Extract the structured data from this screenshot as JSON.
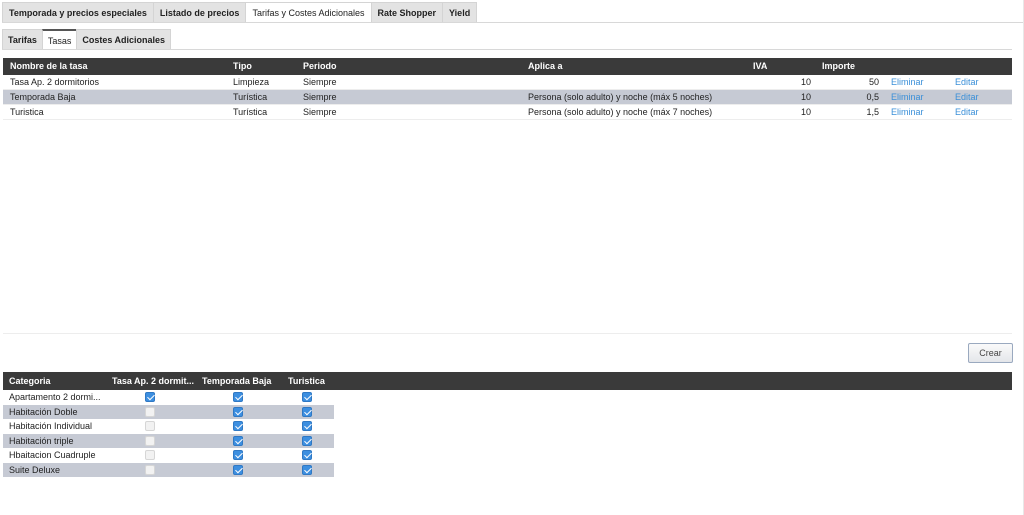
{
  "top_tabs": [
    "Temporada y precios especiales",
    "Listado de precios",
    "Tarifas y  Costes Adicionales",
    "Rate Shopper",
    "Yield"
  ],
  "sub_tabs": [
    "Tarifas",
    "Tasas",
    "Costes Adicionales"
  ],
  "taxes": {
    "headers": {
      "name": "Nombre de la tasa",
      "tipo": "Tipo",
      "periodo": "Periodo",
      "aplica": "Aplica a",
      "iva": "IVA",
      "importe": "Importe"
    },
    "rows": [
      {
        "name": "Tasa Ap. 2 dormitorios",
        "tipo": "Limpieza",
        "periodo": "Siempre",
        "aplica": "",
        "iva": "10",
        "importe": "50",
        "delete": "Eliminar",
        "edit": "Editar"
      },
      {
        "name": "Temporada Baja",
        "tipo": "Turística",
        "periodo": "Siempre",
        "aplica": "Persona (solo adulto)  y noche (máx 5 noches)",
        "iva": "10",
        "importe": "0,5",
        "delete": "Eliminar",
        "edit": "Editar"
      },
      {
        "name": "Turistica",
        "tipo": "Turística",
        "periodo": "Siempre",
        "aplica": "Persona (solo adulto)  y noche (máx 7 noches)",
        "iva": "10",
        "importe": "1,5",
        "delete": "Eliminar",
        "edit": "Editar"
      }
    ]
  },
  "create_button": "Crear",
  "categories": {
    "headers": {
      "cat": "Categoria",
      "h1": "Tasa Ap. 2 dormit...",
      "h2": "Temporada Baja",
      "h3": "Turistica"
    },
    "rows": [
      {
        "name": "Apartamento 2 dormi...",
        "checks": [
          true,
          true,
          true
        ]
      },
      {
        "name": "Habitación Doble",
        "checks": [
          false,
          true,
          true
        ]
      },
      {
        "name": "Habitación Individual",
        "checks": [
          false,
          true,
          true
        ]
      },
      {
        "name": "Habitación triple",
        "checks": [
          false,
          true,
          true
        ]
      },
      {
        "name": "Hbaitacion Cuadruple",
        "checks": [
          false,
          true,
          true
        ]
      },
      {
        "name": "Suite Deluxe",
        "checks": [
          false,
          true,
          true
        ]
      }
    ]
  },
  "colors": {
    "header_bg": "#3a3a3a",
    "row_alt": "#c6cad4",
    "link": "#3a8fd8",
    "check_on": "#3d8fe0"
  }
}
